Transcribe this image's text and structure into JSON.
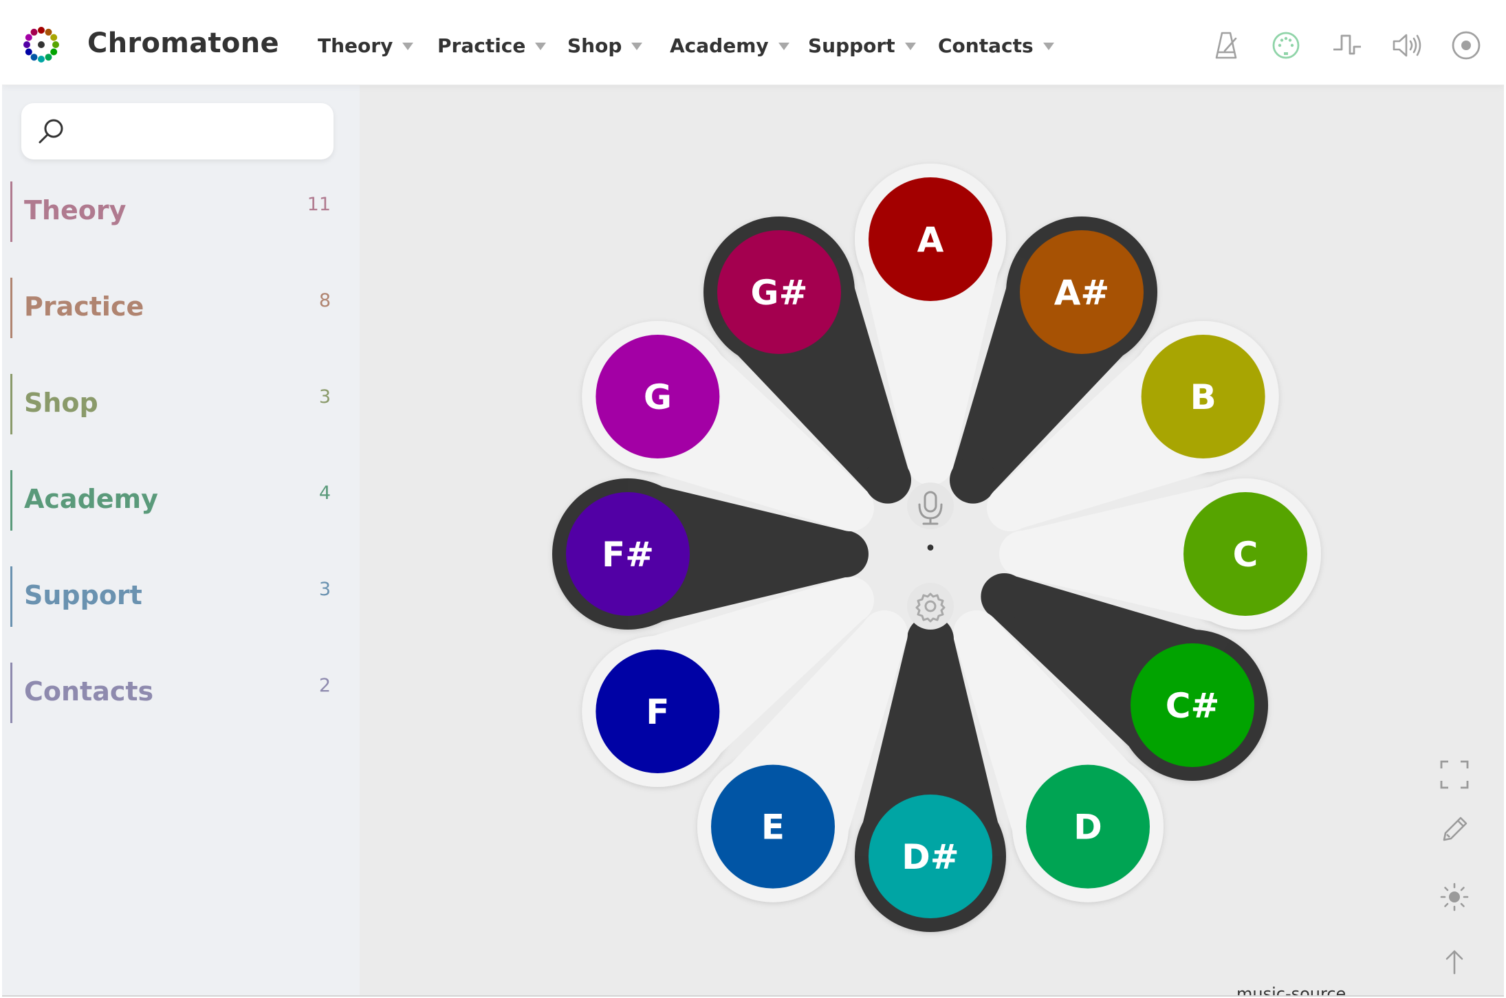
{
  "header": {
    "brand": "Chromatone",
    "nav": [
      {
        "label": "Theory"
      },
      {
        "label": "Practice"
      },
      {
        "label": "Shop"
      },
      {
        "label": "Academy"
      },
      {
        "label": "Support"
      },
      {
        "label": "Contacts"
      }
    ],
    "tools": [
      "metronome-icon",
      "midi-icon",
      "synth-wave-icon",
      "speaker-icon",
      "record-icon"
    ]
  },
  "sidebar": {
    "search": {
      "placeholder": "",
      "value": ""
    },
    "items": [
      {
        "label": "Theory",
        "count": "11",
        "color": "#b07a8f"
      },
      {
        "label": "Practice",
        "count": "8",
        "color": "#b08470"
      },
      {
        "label": "Shop",
        "count": "3",
        "color": "#8a9a6a"
      },
      {
        "label": "Academy",
        "count": "4",
        "color": "#5a9a7a"
      },
      {
        "label": "Support",
        "count": "3",
        "color": "#6a92b0"
      },
      {
        "label": "Contacts",
        "count": "2",
        "color": "#8e8aae"
      }
    ]
  },
  "wheel": {
    "notes": [
      {
        "name": "A",
        "color": "#a30000",
        "sharp": false
      },
      {
        "name": "A#",
        "color": "#a75204",
        "sharp": true
      },
      {
        "name": "B",
        "color": "#a8a502",
        "sharp": false
      },
      {
        "name": "C",
        "color": "#56a400",
        "sharp": false
      },
      {
        "name": "C#",
        "color": "#01a300",
        "sharp": true
      },
      {
        "name": "D",
        "color": "#00a453",
        "sharp": false
      },
      {
        "name": "D#",
        "color": "#00a5a4",
        "sharp": true
      },
      {
        "name": "E",
        "color": "#0155a5",
        "sharp": false
      },
      {
        "name": "F",
        "color": "#0002a5",
        "sharp": false
      },
      {
        "name": "F#",
        "color": "#5200a5",
        "sharp": true
      },
      {
        "name": "G",
        "color": "#a300a5",
        "sharp": false
      },
      {
        "name": "G#",
        "color": "#a4004f",
        "sharp": true
      }
    ],
    "center_dot": "•",
    "center_tools": [
      "microphone-icon",
      "gear-icon"
    ]
  },
  "side_tools": [
    "fullscreen-icon",
    "pencil-icon",
    "brightness-icon",
    "arrow-up-icon"
  ],
  "footer_text": "music-source"
}
